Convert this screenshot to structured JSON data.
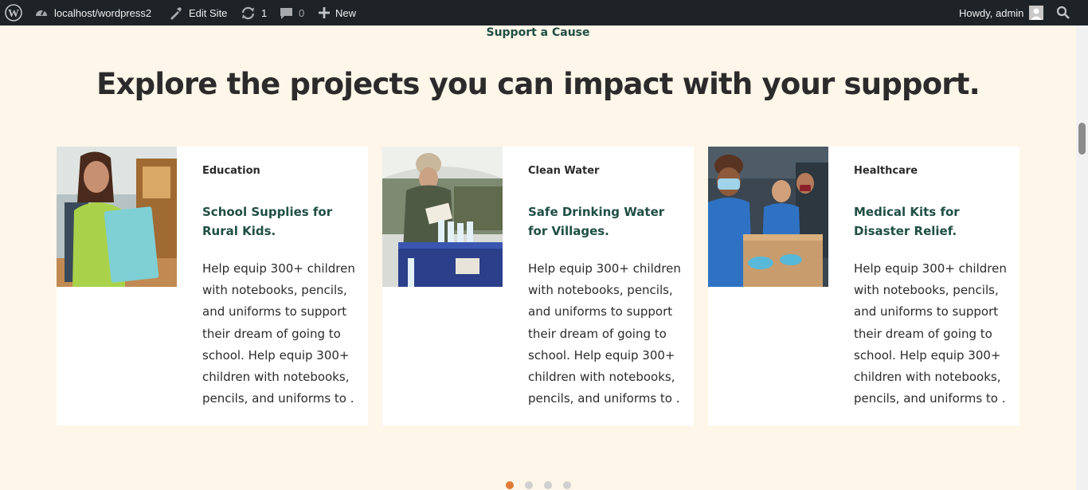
{
  "adminbar": {
    "site": "localhost/wordpress2",
    "edit_site": "Edit Site",
    "updates_count": "1",
    "comments_count": "0",
    "new_label": "New",
    "greeting": "Howdy, admin"
  },
  "section": {
    "eyebrow": "Support a Cause",
    "headline": "Explore the projects you can impact with your support."
  },
  "cards": [
    {
      "category": "Education",
      "title": "School Supplies for Rural Kids.",
      "description": "Help equip 300+ children with notebooks, pencils, and uniforms to support their dream of going to school. Help equip 300+ children with notebooks, pencils, and uniforms to ."
    },
    {
      "category": "Clean Water",
      "title": "Safe Drinking Water for Villages.",
      "description": "Help equip 300+ children with notebooks, pencils, and uniforms to support their dream of going to school. Help equip 300+ children with notebooks, pencils, and uniforms to ."
    },
    {
      "category": "Healthcare",
      "title": "Medical Kits for Disaster Relief.",
      "description": "Help equip 300+ children with notebooks, pencils, and uniforms to support their dream of going to school. Help equip 300+ children with notebooks, pencils, and uniforms to ."
    }
  ],
  "carousel": {
    "total": 4,
    "active_index": 0
  },
  "colors": {
    "accent": "#e07b39",
    "brand_green": "#1f4e44",
    "background": "#fdf6e9",
    "adminbar": "#1d2327"
  },
  "icons": [
    "wordpress-logo-icon",
    "dashboard-icon",
    "edit-site-icon",
    "updates-icon",
    "comments-icon",
    "plus-icon",
    "avatar",
    "search-icon"
  ]
}
